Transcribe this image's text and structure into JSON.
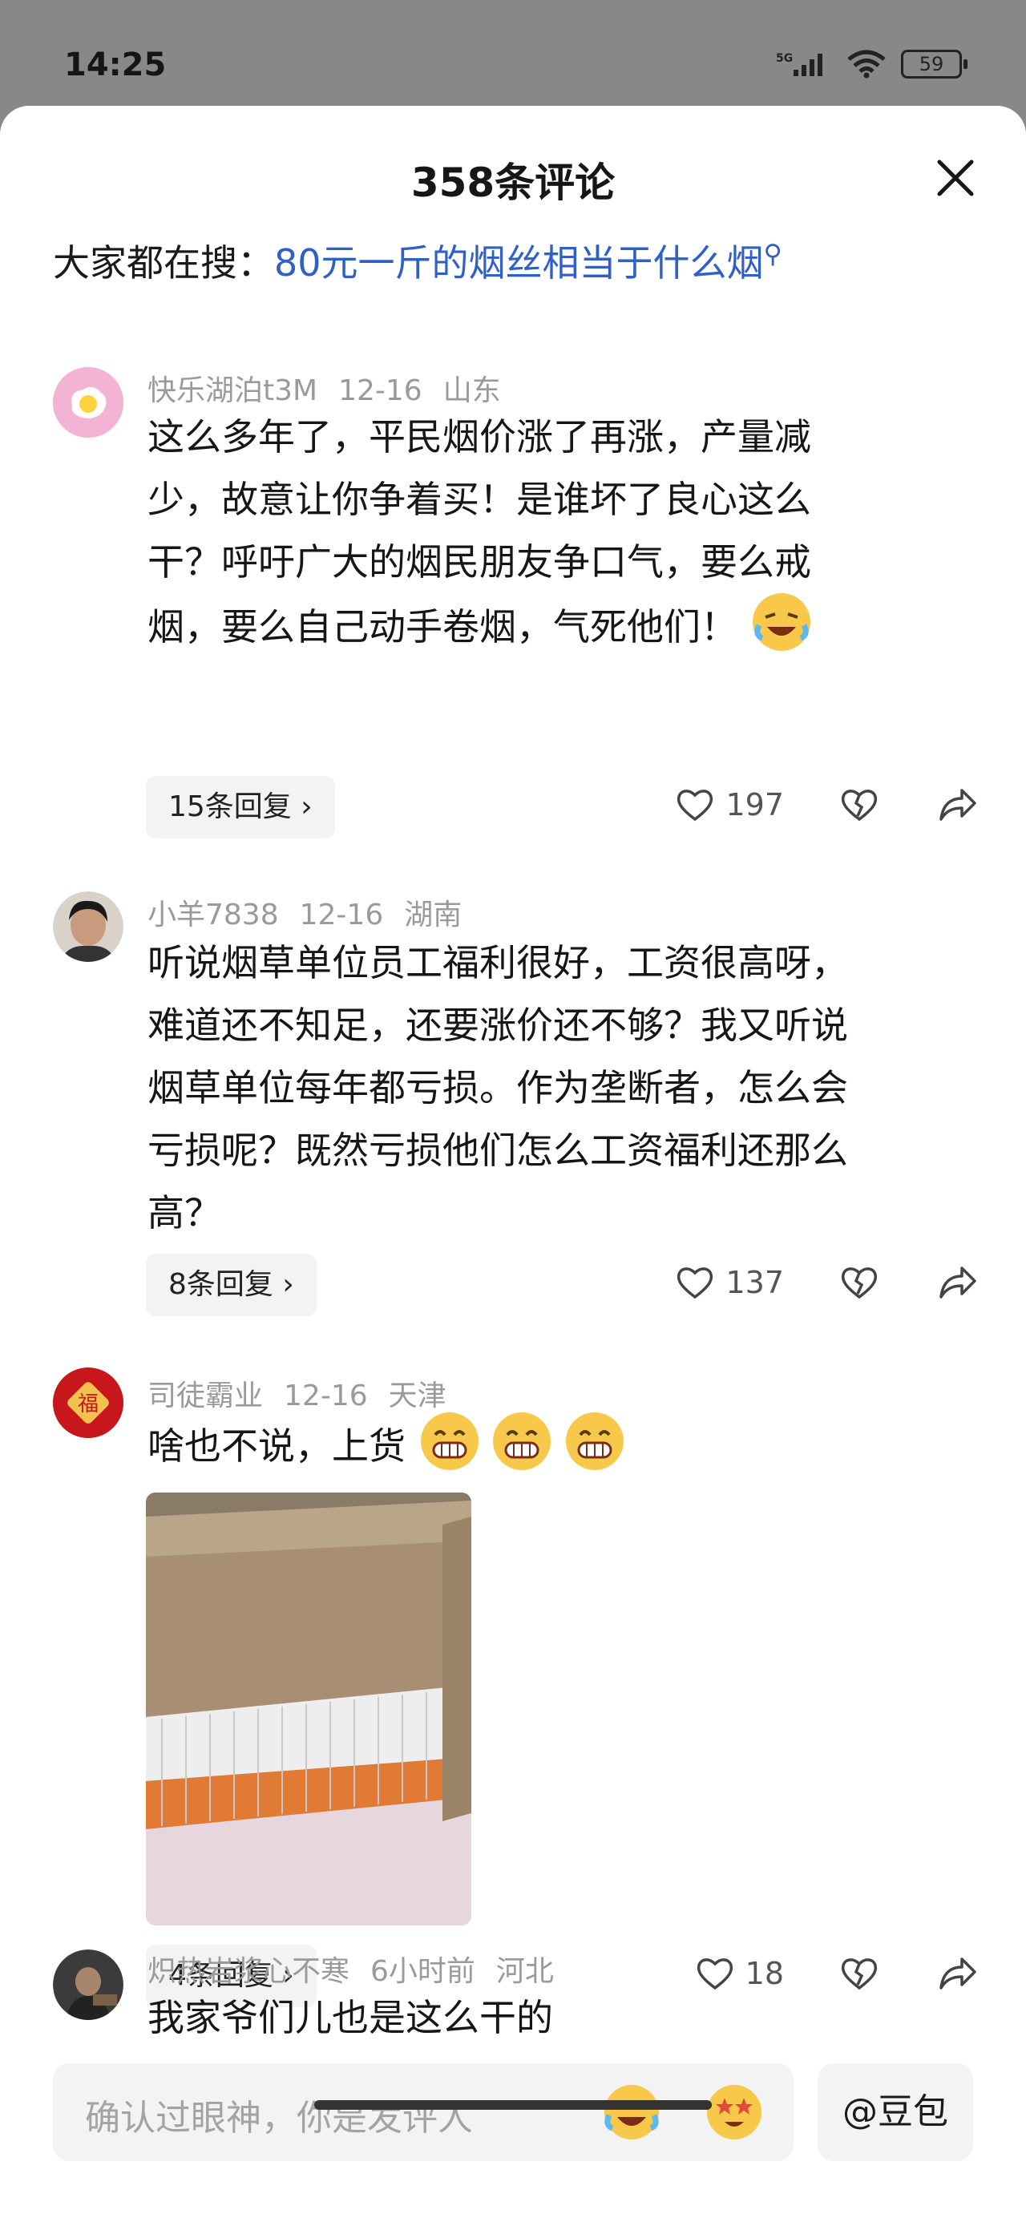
{
  "status": {
    "time": "14:25",
    "network": "5G",
    "battery": "59"
  },
  "header": {
    "title": "358条评论"
  },
  "search": {
    "prefix": "大家都在搜：",
    "query": "80元一斤的烟丝相当于什么烟"
  },
  "comments": [
    {
      "user": "快乐湖泊t3M",
      "date": "12-16",
      "location": "山东",
      "lines": [
        "这么多年了，平民烟价涨了再涨，产量减",
        "少，故意让你争着买！是谁坏了良心这么",
        "干？呼吁广大的烟民朋友争口气，要么戒",
        "烟，要么自己动手卷烟，气死他们！"
      ],
      "replies": "15条回复",
      "likes": "197"
    },
    {
      "user": "小羊7838",
      "date": "12-16",
      "location": "湖南",
      "lines": [
        "听说烟草单位员工福利很好，工资很高呀，",
        "难道还不知足，还要涨价还不够？我又听说",
        "烟草单位每年都亏损。作为垄断者，怎么会",
        "亏损呢？既然亏损他们怎么工资福利还那么",
        "高？"
      ],
      "replies": "8条回复",
      "likes": "137"
    },
    {
      "user": "司徒霸业",
      "date": "12-16",
      "location": "天津",
      "lines": [
        "啥也不说，上货"
      ],
      "avatar_text": "福",
      "replies": "4条回复",
      "likes": "18"
    },
    {
      "user": "炽热岩浆心不寒",
      "date": "6小时前",
      "location": "河北",
      "lines": [
        "我家爷们儿也是这么干的"
      ]
    }
  ],
  "bottom": {
    "placeholder": "确认过眼神，你是发评人",
    "doubao": "@豆包"
  },
  "colors": {
    "link": "#2f5fc7",
    "meta": "#9a9a9a",
    "chip": "#f3f3f3"
  }
}
